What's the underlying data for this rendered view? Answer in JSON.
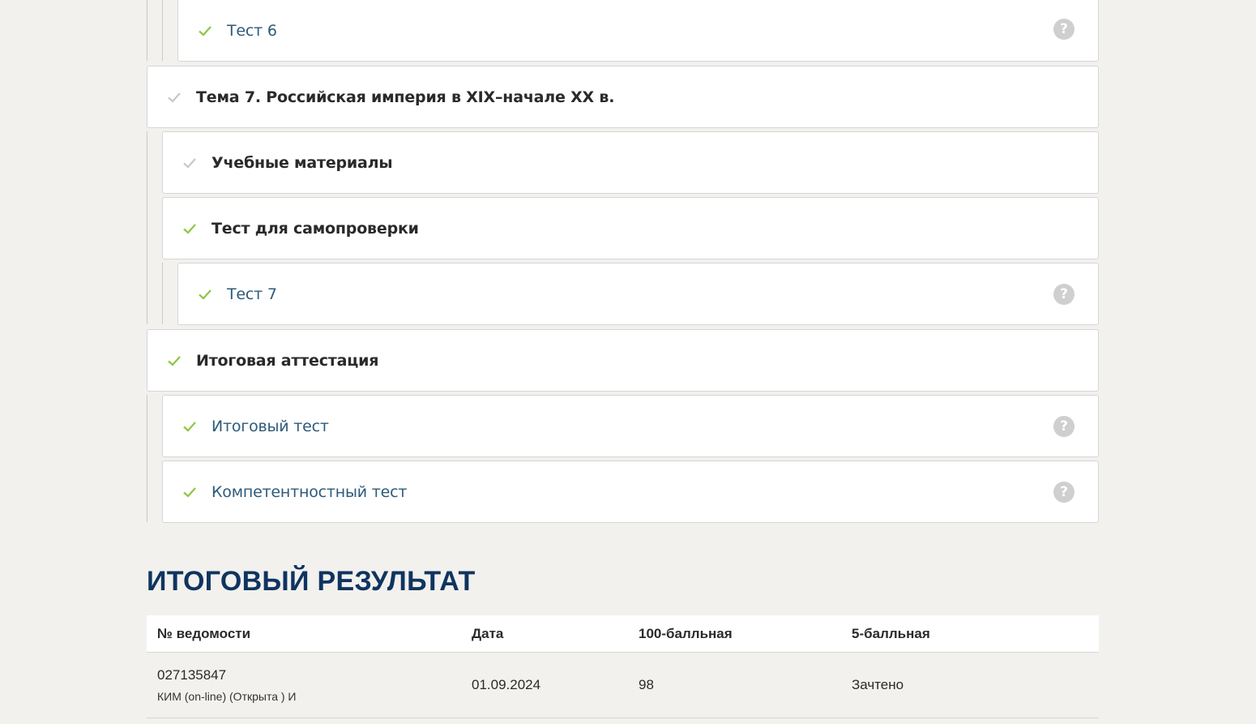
{
  "course_items": [
    {
      "label": "Тест 6",
      "kind": "link",
      "completed": true,
      "help": "?"
    },
    {
      "label": "Тема 7. Российская империя в XIX–начале XX в.",
      "kind": "heading",
      "completed": false
    },
    {
      "label": "Учебные материалы",
      "kind": "heading",
      "completed": false
    },
    {
      "label": "Тест для самопроверки",
      "kind": "heading",
      "completed": true
    },
    {
      "label": "Тест 7",
      "kind": "link",
      "completed": true,
      "help": "?"
    },
    {
      "label": "Итоговая аттестация",
      "kind": "heading",
      "completed": true
    },
    {
      "label": "Итоговый тест",
      "kind": "link",
      "completed": true,
      "help": "?"
    },
    {
      "label": "Компетентностный тест",
      "kind": "link",
      "completed": true,
      "help": "?"
    }
  ],
  "result": {
    "title": "ИТОГОВЫЙ РЕЗУЛЬТАТ",
    "columns": [
      "№ ведомости",
      "Дата",
      "100-балльная",
      "5-балльная"
    ],
    "rows": [
      {
        "number": "027135847",
        "type": "КИМ (on-line) (Открыта ) И",
        "date": "01.09.2024",
        "score100": "98",
        "score5": "Зачтено"
      }
    ]
  },
  "colors": {
    "check_done": "#8dc63f",
    "check_pending": "#c8c8c8",
    "link": "#2d5a7a",
    "title": "#0f3460",
    "background": "#f2f1ee"
  },
  "icons": {
    "done": "check-icon",
    "pending": "check-icon",
    "help": "help-icon"
  }
}
